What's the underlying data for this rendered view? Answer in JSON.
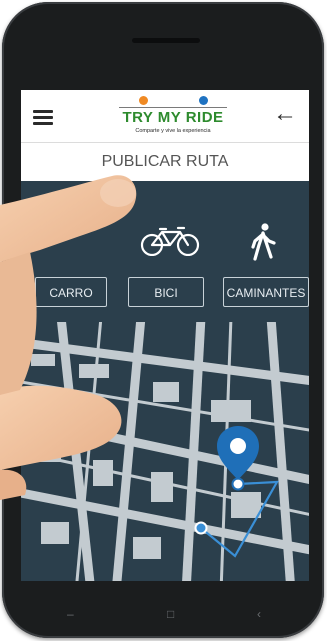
{
  "app": {
    "logo_text": "TRY MY RIDE",
    "logo_tagline": "Comparte y vive la experiencia",
    "page_title": "PUBLICAR RUTA"
  },
  "icons": {
    "menu": "hamburger-icon",
    "back": "back-arrow-icon",
    "bike": "bicycle-icon",
    "walk": "walking-person-icon",
    "pin": "map-pin-icon"
  },
  "modes": [
    {
      "label": "CARRO"
    },
    {
      "label": "BICI"
    },
    {
      "label": "CAMINANTES"
    }
  ],
  "colors": {
    "background": "#2b3f4c",
    "logo_green": "#2e8b2e",
    "logo_orange": "#f08a24",
    "logo_blue": "#1f73c2",
    "route": "#3a8fd6",
    "pin": "#1f6fb8"
  },
  "nav": {
    "back_glyph": "‹",
    "home_glyph": "□",
    "recent_glyph": "–"
  }
}
